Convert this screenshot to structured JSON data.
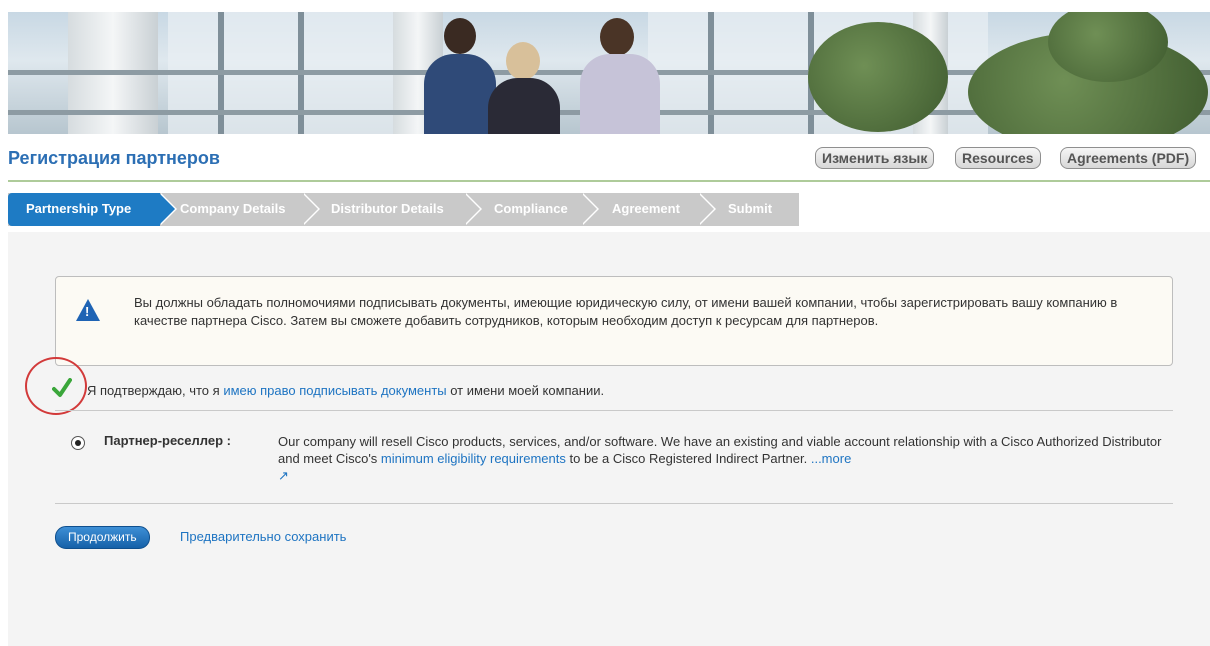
{
  "header": {
    "title": "Регистрация партнеров",
    "buttons": [
      "Изменить язык",
      "Resources",
      "Agreements (PDF)"
    ]
  },
  "steps": [
    "Partnership Type",
    "Company Details",
    "Distributor Details",
    "Compliance",
    "Agreement",
    "Submit"
  ],
  "alert": {
    "text": "Вы должны обладать полномочиями подписывать документы, имеющие юридическую силу, от имени вашей компании, чтобы зарегистрировать вашу компанию в качестве партнера Cisco. Затем вы сможете добавить сотрудников, которым необходим доступ к ресурсам для партнеров."
  },
  "confirm": {
    "checked": true,
    "prefix": "Я подтверждаю, что я ",
    "link": "имею право подписывать документы",
    "suffix": " от имени моей компании."
  },
  "option": {
    "selected": true,
    "label": "Партнер-реселлер  :",
    "text1": "Our company will resell Cisco products, services, and/or software. We have an existing and viable account relationship with a Cisco Authorized Distributor and meet Cisco's ",
    "link": "minimum eligibility requirements",
    "text2": " to be a Cisco Registered Indirect Partner. ",
    "more": "...more",
    "ext_icon": "external-link-icon"
  },
  "actions": {
    "continue": "Продолжить",
    "save_draft": "Предварительно сохранить"
  },
  "colors": {
    "brand_blue": "#2c6fb4",
    "step_active": "#1e7bc4",
    "step_inactive": "#c9c9c9",
    "check_green": "#3aa63a",
    "highlight_red": "#d23a3a"
  }
}
